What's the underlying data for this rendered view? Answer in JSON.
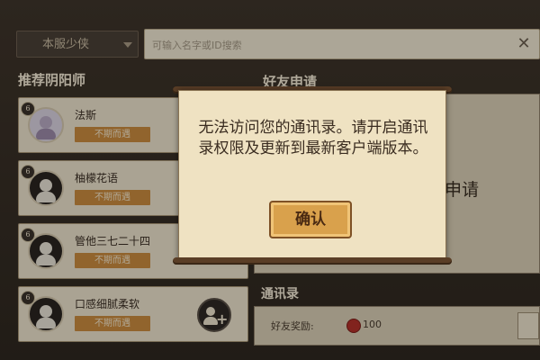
{
  "topbar": {
    "server_label": "本服少侠",
    "search_placeholder": "可输入名字或ID搜索"
  },
  "sections": {
    "left_title": "推荐阴阳师",
    "right_title": "好友申请",
    "contacts_title": "通讯录"
  },
  "recommend_list": [
    {
      "name": "法斯",
      "tag": "不期而遇",
      "level": "6"
    },
    {
      "name": "柚檬花语",
      "tag": "不期而遇",
      "level": "6"
    },
    {
      "name": "管他三七二十四",
      "tag": "不期而遇",
      "level": "6"
    },
    {
      "name": "口感细腻柔软",
      "tag": "不期而遇",
      "level": "6"
    }
  ],
  "right_panel": {
    "apply_bg_text": "申请"
  },
  "contacts": {
    "friend_gold_label": "好友奖励:",
    "coin_value": "100"
  },
  "dialog": {
    "message": "无法访问您的通讯录。请开启通讯录权限及更新到最新客户端版本。",
    "confirm_label": "确认"
  },
  "colors": {
    "paper": "#efe2c2",
    "button": "#d9a14c",
    "tag": "#c98b3f",
    "background": "#3a3128"
  }
}
